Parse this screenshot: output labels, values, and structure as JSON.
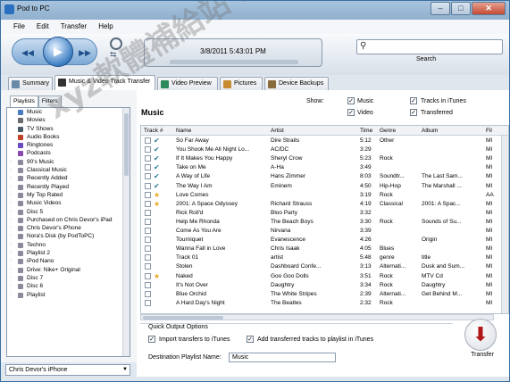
{
  "window": {
    "title": "Pod to PC",
    "min": "–",
    "max": "□",
    "close": "✕"
  },
  "menu": [
    "File",
    "Edit",
    "Transfer",
    "Help"
  ],
  "toolbar": {
    "prev": "◀◀",
    "play": "▶",
    "next": "▶▶",
    "datetime": "3/8/2011 5:43:01 PM",
    "search_placeholder": "",
    "search_label": "Search"
  },
  "tabs": [
    {
      "label": "Summary",
      "color": "#6a8aa8"
    },
    {
      "label": "Music & Video Track Transfer",
      "color": "#333333"
    },
    {
      "label": "Video Preview",
      "color": "#2a8a5a"
    },
    {
      "label": "Pictures",
      "color": "#c88a30"
    },
    {
      "label": "Device Backups",
      "color": "#8a6a3a"
    }
  ],
  "left": {
    "ptabs": [
      "Playlists",
      "Filters"
    ],
    "playlists": [
      {
        "label": "Music",
        "color": "#4a7ac0"
      },
      {
        "label": "Movies",
        "color": "#6a6a6a"
      },
      {
        "label": "TV Shows",
        "color": "#4a5a6a"
      },
      {
        "label": "Audio Books",
        "color": "#c0402a"
      },
      {
        "label": "Ringtones",
        "color": "#6a4ac0"
      },
      {
        "label": "Podcasts",
        "color": "#8a4ab0"
      },
      {
        "label": "90's Music",
        "color": "#8a8a9a"
      },
      {
        "label": "Classical Music",
        "color": "#8a8a9a"
      },
      {
        "label": "Recently Added",
        "color": "#8a8a9a"
      },
      {
        "label": "Recently Played",
        "color": "#8a8a9a"
      },
      {
        "label": "My Top Rated",
        "color": "#8a8a9a"
      },
      {
        "label": "Music Videos",
        "color": "#8a8a9a"
      },
      {
        "label": "Disc 5",
        "color": "#8a8a9a"
      },
      {
        "label": "Purchased on Chris Devor's iPad",
        "color": "#8a8a9a"
      },
      {
        "label": "Chris Devor's iPhone",
        "color": "#8a8a9a"
      },
      {
        "label": "Nora's Disk (by PodToPC)",
        "color": "#8a8a9a"
      },
      {
        "label": "Techno",
        "color": "#8a8a9a"
      },
      {
        "label": "Playlist 2",
        "color": "#8a8a9a"
      },
      {
        "label": "iPod Nano",
        "color": "#8a8a9a"
      },
      {
        "label": "Drive: Nike+ Original",
        "color": "#8a8a9a"
      },
      {
        "label": "Disc 7",
        "color": "#8a8a9a"
      },
      {
        "label": "Disc 6",
        "color": "#8a8a9a"
      },
      {
        "label": "Playlist",
        "color": "#8a8a9a"
      }
    ],
    "device": "Chris Devor's iPhone"
  },
  "main": {
    "title": "Music",
    "show_label": "Show:",
    "checks": [
      {
        "label": "Music",
        "checked": true
      },
      {
        "label": "Video",
        "checked": true
      },
      {
        "label": "Tracks in iTunes",
        "checked": true
      },
      {
        "label": "Transferred",
        "checked": true
      }
    ],
    "columns": [
      "Track #",
      "Name",
      "Artist",
      "Time",
      "Genre",
      "Album",
      "Fil"
    ],
    "rows": [
      {
        "status": "check",
        "name": "So Far Away",
        "artist": "Dire Straits",
        "time": "5:12",
        "genre": "Other",
        "album": "",
        "file": "MI"
      },
      {
        "status": "check",
        "name": "You Shook Me All Night Lo...",
        "artist": "AC/DC",
        "time": "3:29",
        "genre": "",
        "album": "",
        "file": "MI"
      },
      {
        "status": "check",
        "name": "If It Makes You Happy",
        "artist": "Sheryl Crow",
        "time": "5:23",
        "genre": "Rock",
        "album": "",
        "file": "MI"
      },
      {
        "status": "check",
        "name": "Take on Me",
        "artist": "A-Ha",
        "time": "3:49",
        "genre": "",
        "album": "",
        "file": "MI"
      },
      {
        "status": "check",
        "name": "A Way of Life",
        "artist": "Hans Zimmer",
        "time": "8:03",
        "genre": "Soundtr...",
        "album": "The Last Sam...",
        "file": "MI"
      },
      {
        "status": "check",
        "name": "The Way I Am",
        "artist": "Eminem",
        "time": "4:50",
        "genre": "Hip-Hop",
        "album": "The Marshall ...",
        "file": "MI"
      },
      {
        "status": "star",
        "name": "Love Comes",
        "artist": "",
        "time": "3:19",
        "genre": "Rock",
        "album": "",
        "file": "AA"
      },
      {
        "status": "star",
        "name": "2001: A Space Odyssey",
        "artist": "Richard Strauss",
        "time": "4:19",
        "genre": "Classical",
        "album": "2001: A Spac...",
        "file": "MI"
      },
      {
        "status": "none",
        "name": "Rick Roll'd",
        "artist": "Bloo Party",
        "time": "3:32",
        "genre": "",
        "album": "",
        "file": "MI"
      },
      {
        "status": "none",
        "name": "Help Me Rhonda",
        "artist": "The Beach Boys",
        "time": "3:30",
        "genre": "Rock",
        "album": "Sounds of Su...",
        "file": "MI"
      },
      {
        "status": "none",
        "name": "Come As You Are",
        "artist": "Nirvana",
        "time": "3:39",
        "genre": "",
        "album": "",
        "file": "MI"
      },
      {
        "status": "none",
        "name": "Tourniquet",
        "artist": "Evanescence",
        "time": "4:26",
        "genre": "",
        "album": "Origin",
        "file": "MI"
      },
      {
        "status": "none",
        "name": "Wanna Fall in Love",
        "artist": "Chris Isaak",
        "time": "4:05",
        "genre": "Blues",
        "album": "",
        "file": "MI"
      },
      {
        "status": "none",
        "name": "Track 01",
        "artist": "artist",
        "time": "5:48",
        "genre": "genre",
        "album": "title",
        "file": "MI"
      },
      {
        "status": "none",
        "name": "Stolen",
        "artist": "Dashboard Confe...",
        "time": "3:13",
        "genre": "Alternati...",
        "album": "Dusk and Sum...",
        "file": "MI"
      },
      {
        "status": "star",
        "name": "Naked",
        "artist": "Goo Goo Dolls",
        "time": "3:51",
        "genre": "Rock",
        "album": "MTV Cd",
        "file": "MI"
      },
      {
        "status": "none",
        "name": "It's Not Over",
        "artist": "Daughtry",
        "time": "3:34",
        "genre": "Rock",
        "album": "Daughtry",
        "file": "MI"
      },
      {
        "status": "none",
        "name": "Blue Orchid",
        "artist": "The White Stripes",
        "time": "2:39",
        "genre": "Alternati...",
        "album": "Get Behind M...",
        "file": "MI"
      },
      {
        "status": "none",
        "name": "A Hard Day's Night",
        "artist": "The Beatles",
        "time": "2:32",
        "genre": "Rock",
        "album": "",
        "file": "MI"
      }
    ],
    "quick_output": {
      "title": "Quick Output Options",
      "import_label": "Import transfers to iTunes",
      "add_label": "Add transferred tracks to playlist in iTunes",
      "dest_label": "Destination Playlist Name:",
      "dest_value": "Music"
    },
    "transfer_label": "Transfer"
  },
  "watermark": "xyz軟體補給站 http://31.to",
  "colors": {
    "accent": "#3d7fc4",
    "transfer_arrow": "#b01818",
    "star": "#e8a820",
    "check": "#2a7a9a"
  }
}
